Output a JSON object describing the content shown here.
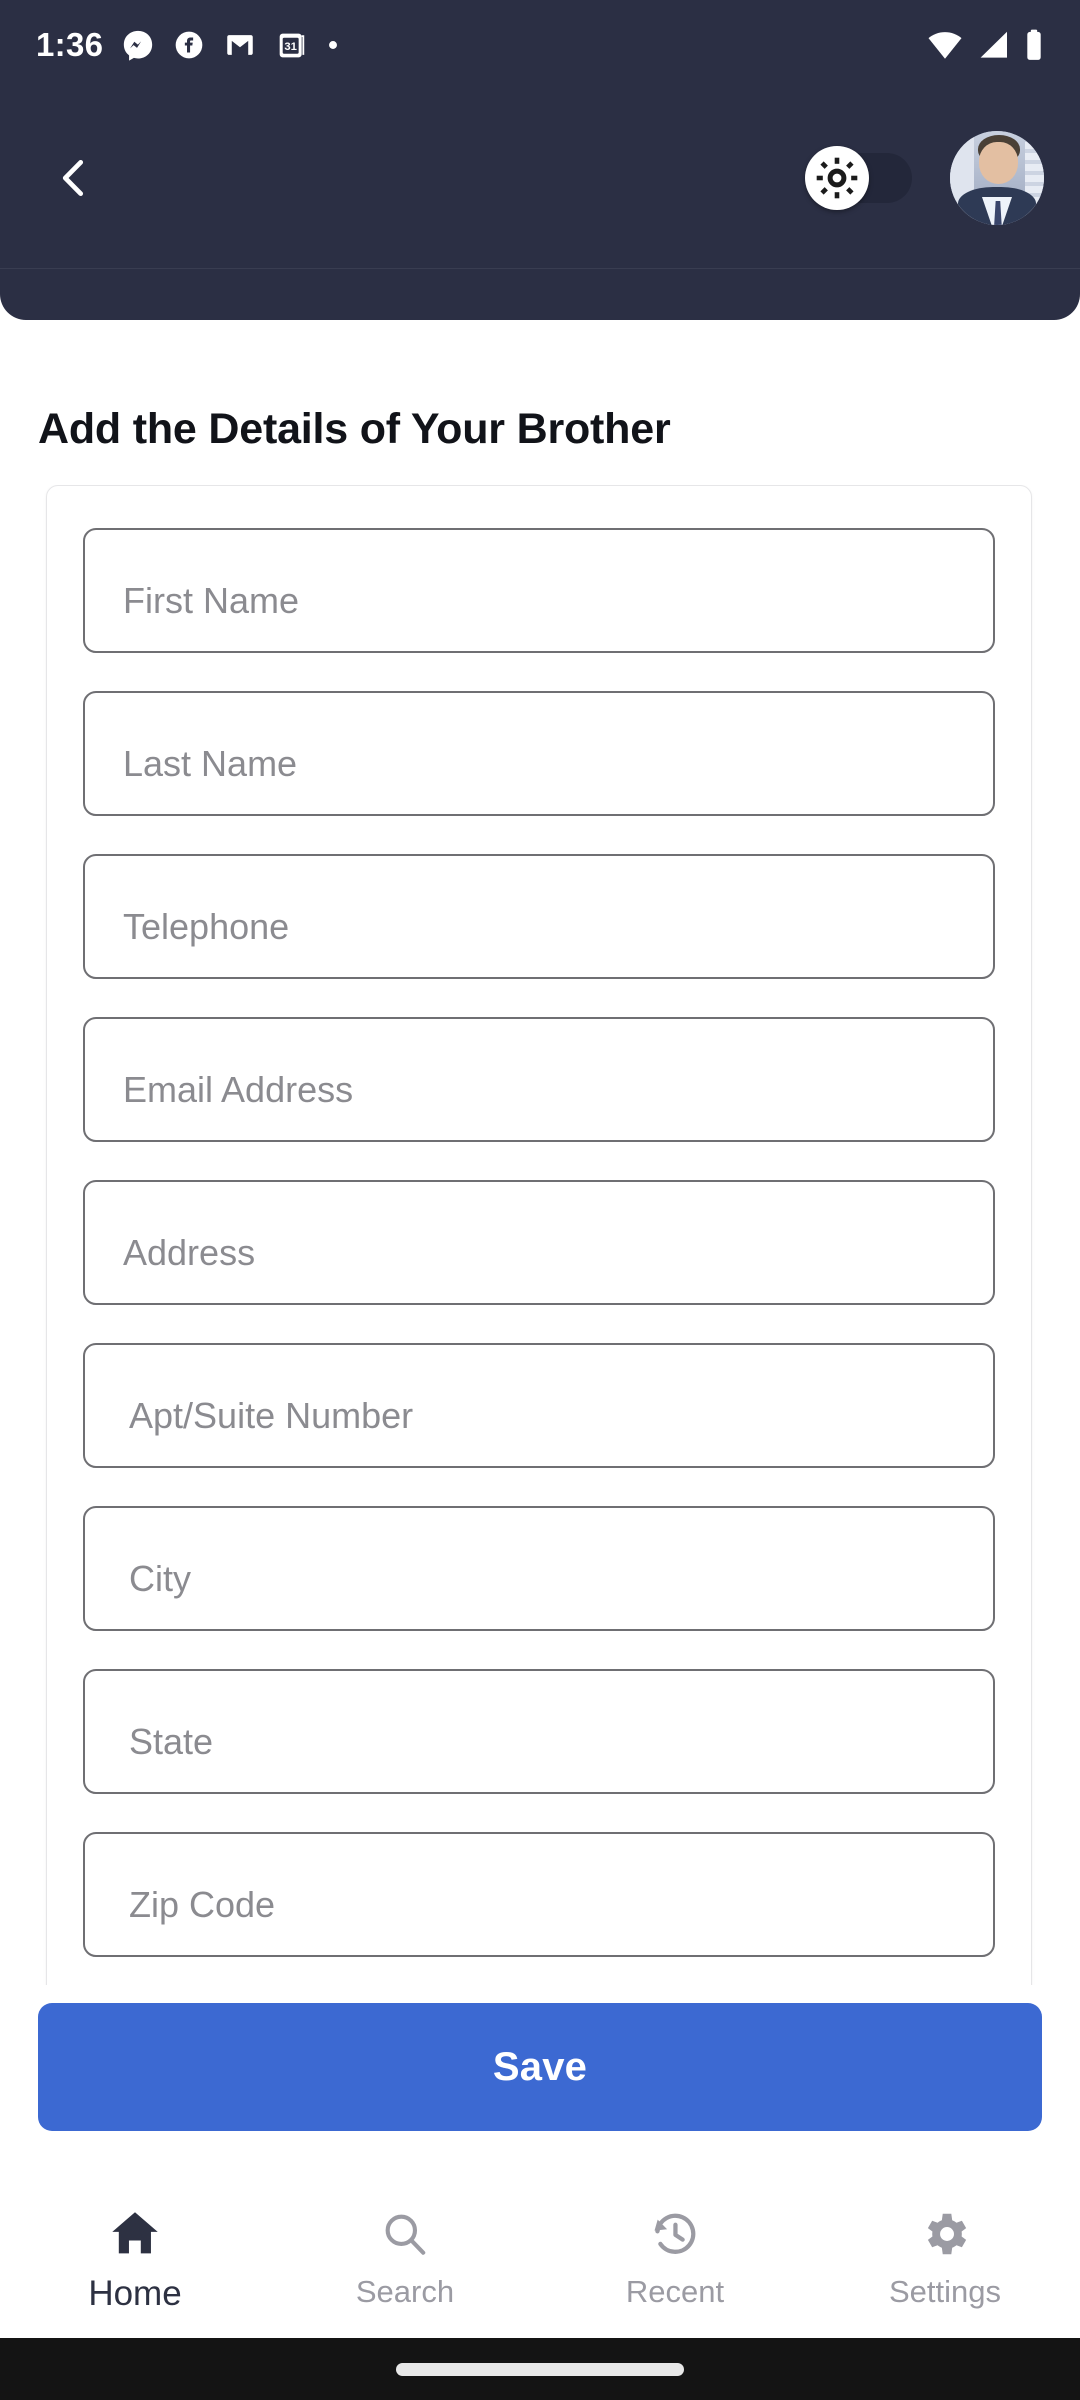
{
  "status_bar": {
    "time": "1:36",
    "left_icons": [
      "messenger-icon",
      "facebook-icon",
      "gmail-icon",
      "calendar-31-icon",
      "dot-icon"
    ],
    "calendar_day": "31",
    "right_icons": [
      "wifi-icon",
      "cellular-signal-icon",
      "battery-icon"
    ]
  },
  "header": {
    "background_color": "#2B2F44",
    "back_label": "Back",
    "theme_toggle": {
      "name": "theme-toggle",
      "state": "off",
      "knob_icon": "sun-brightness-icon",
      "track_color": "#23273A",
      "knob_color": "#FFFFFF"
    },
    "avatar_label": "User profile"
  },
  "page": {
    "title": "Add the Details of Your Brother"
  },
  "form": {
    "fields": [
      {
        "name": "first-name",
        "placeholder": "First Name",
        "value": ""
      },
      {
        "name": "last-name",
        "placeholder": "Last Name",
        "value": ""
      },
      {
        "name": "telephone",
        "placeholder": "Telephone",
        "value": ""
      },
      {
        "name": "email",
        "placeholder": "Email Address",
        "value": ""
      },
      {
        "name": "address",
        "placeholder": "Address",
        "value": ""
      },
      {
        "name": "apt-suite",
        "placeholder": "Apt/Suite Number",
        "value": ""
      },
      {
        "name": "city",
        "placeholder": "City",
        "value": ""
      },
      {
        "name": "state",
        "placeholder": "State",
        "value": ""
      },
      {
        "name": "zip-code",
        "placeholder": "Zip Code",
        "value": ""
      }
    ]
  },
  "actions": {
    "save_label": "Save",
    "save_color": "#3C69D2"
  },
  "bottom_nav": {
    "active": "Home",
    "items": [
      {
        "label": "Home",
        "icon": "home-icon",
        "active": true
      },
      {
        "label": "Search",
        "icon": "search-icon",
        "active": false
      },
      {
        "label": "Recent",
        "icon": "history-icon",
        "active": false
      },
      {
        "label": "Settings",
        "icon": "gear-icon",
        "active": false
      }
    ],
    "active_color": "#2D3142",
    "inactive_color": "#9B9BA3"
  }
}
